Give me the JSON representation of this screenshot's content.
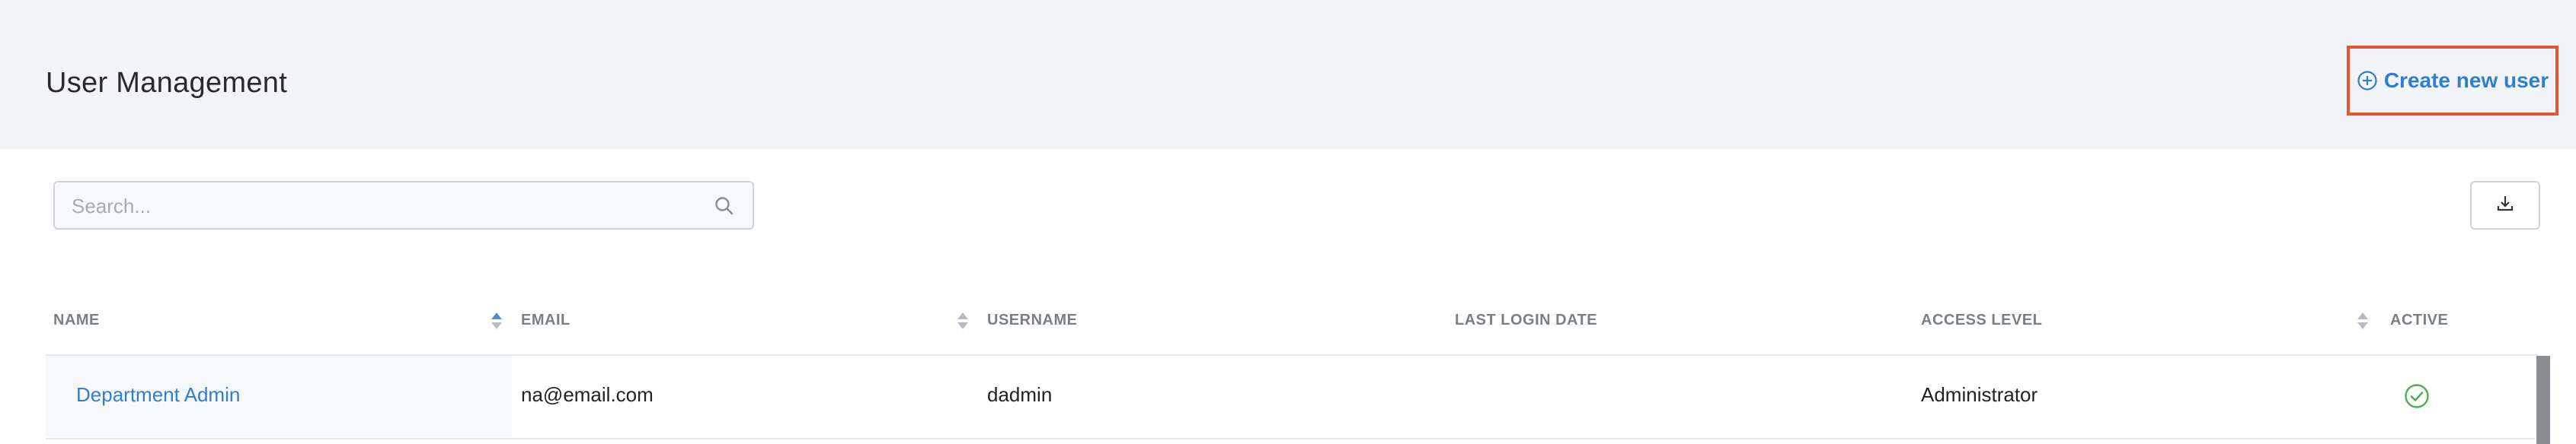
{
  "header": {
    "title": "User Management",
    "create_label": "Create new user"
  },
  "search": {
    "placeholder": "Search...",
    "value": ""
  },
  "table": {
    "columns": [
      "NAME",
      "EMAIL",
      "USERNAME",
      "LAST LOGIN DATE",
      "ACCESS LEVEL",
      "ACTIVE"
    ],
    "rows": [
      {
        "name": "Department Admin",
        "email": "na@email.com",
        "username": "dadmin",
        "last_login": "",
        "access_level": "Administrator",
        "active": true
      }
    ]
  },
  "colors": {
    "accent": "#2f7fcf",
    "highlight": "#e4572e",
    "active_green": "#4caf50",
    "header_bg": "#f3f4f7"
  },
  "icons": {
    "create": "plus-circle-icon",
    "search": "search-icon",
    "download": "download-icon",
    "sort": "sort-icon",
    "active": "check-circle-icon"
  }
}
